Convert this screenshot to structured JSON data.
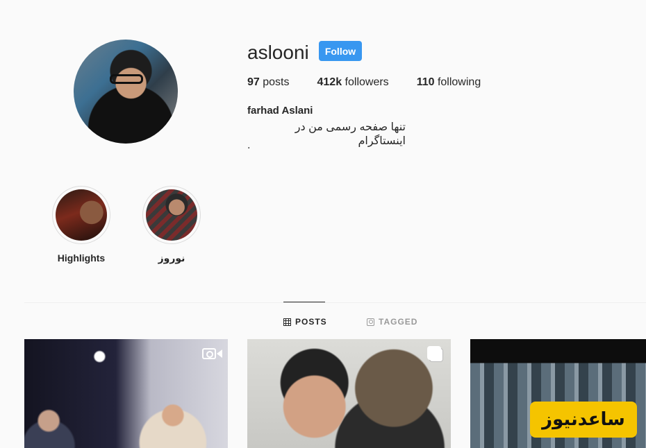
{
  "profile": {
    "username": "aslooni",
    "follow_label": "Follow",
    "stats": [
      {
        "value": "97",
        "label": "posts"
      },
      {
        "value": "412k",
        "label": "followers"
      },
      {
        "value": "110",
        "label": "following"
      }
    ],
    "full_name": "farhad Aslani",
    "bio_line1": "تنها صفحه رسمی من در اینستاگرام",
    "bio_line2": "."
  },
  "highlights": [
    {
      "label": "Highlights"
    },
    {
      "label": "نوروز"
    }
  ],
  "tabs": {
    "posts": "POSTS",
    "tagged": "TAGGED"
  },
  "posts": [
    {
      "type_icon": "video-icon"
    },
    {
      "type_icon": "carousel-icon"
    },
    {
      "type_icon": ""
    }
  ],
  "watermark_text": "ساعدنیوز",
  "colors": {
    "follow_button": "#3897f0",
    "background": "#fafafa",
    "watermark_bg": "#f5c400"
  }
}
